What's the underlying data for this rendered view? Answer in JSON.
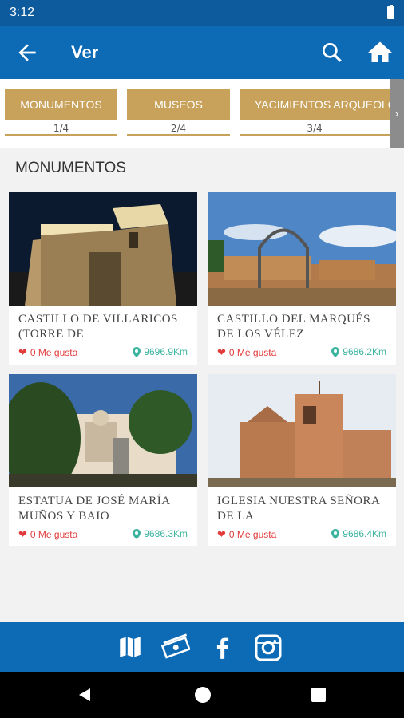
{
  "status_bar": {
    "time": "3:12"
  },
  "app_bar": {
    "title": "Ver",
    "back_icon": "arrow-left-icon",
    "search_icon": "search-icon",
    "home_icon": "home-icon"
  },
  "tabs": [
    {
      "label": "MONUMENTOS",
      "count": "1/4"
    },
    {
      "label": "MUSEOS",
      "count": "2/4"
    },
    {
      "label": "YACIMIENTOS ARQUEOLOG",
      "count": "3/4"
    }
  ],
  "section": {
    "title": "MONUMENTOS"
  },
  "cards": [
    {
      "title": "CASTILLO DE VILLARICOS (TORRE DE",
      "likes": "0 Me gusta",
      "distance": "9696.9Km"
    },
    {
      "title": "CASTILLO DEL MARQUÉS DE LOS VÉLEZ",
      "likes": "0 Me gusta",
      "distance": "9686.2Km"
    },
    {
      "title": "ESTATUA DE JOSÉ MARÍA MUÑOS Y BAIO",
      "likes": "0 Me gusta",
      "distance": "9686.3Km"
    },
    {
      "title": "IGLESIA NUESTRA SEÑORA DE LA",
      "likes": "0 Me gusta",
      "distance": "9686.4Km"
    }
  ],
  "bottom_bar": {
    "icons": [
      "map-icon",
      "money-icon",
      "facebook-icon",
      "instagram-icon"
    ]
  },
  "colors": {
    "primary": "#0d6ab5",
    "status": "#0d5a9c",
    "accent": "#c8a15a",
    "like": "#e23b3b",
    "distance": "#3bb39e"
  }
}
